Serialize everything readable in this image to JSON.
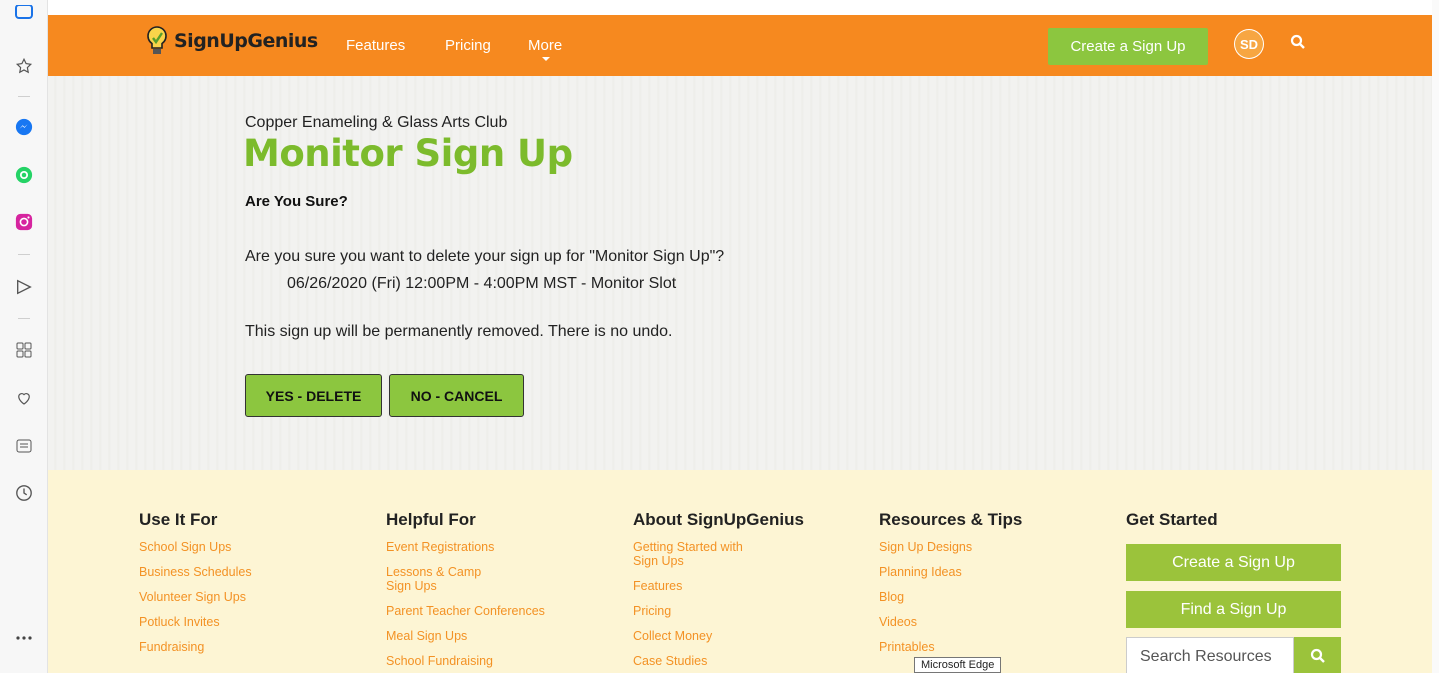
{
  "sidebar": {
    "icons": [
      "app-icon",
      "star-icon",
      "messenger-icon",
      "whatsapp-icon",
      "instagram-icon",
      "send-icon",
      "apps-grid-icon",
      "heart-icon",
      "news-icon",
      "history-icon",
      "more-icon"
    ]
  },
  "nav": {
    "logo_text": "SignUpGenius",
    "links": [
      "Features",
      "Pricing",
      "More"
    ],
    "create_label": "Create a Sign Up",
    "avatar_initials": "SD",
    "accent": "#f6891f"
  },
  "main": {
    "org_name": "Copper Enameling & Glass Arts Club",
    "title": "Monitor Sign Up",
    "subtitle": "Are You Sure?",
    "question": "Are you sure you want to delete your sign up for \"Monitor Sign Up\"?",
    "slot": "06/26/2020 (Fri) 12:00PM - 4:00PM MST - Monitor Slot",
    "warning": "This sign up will be permanently removed. There is no undo.",
    "yes_label": "YES - DELETE",
    "no_label": "NO - CANCEL",
    "title_color": "#7cbb2c"
  },
  "footer": {
    "columns": [
      {
        "heading": "Use It For",
        "links": [
          "School Sign Ups",
          "Business Schedules",
          "Volunteer Sign Ups",
          "Potluck Invites",
          "Fundraising"
        ]
      },
      {
        "heading": "Helpful For",
        "links": [
          "Event Registrations",
          "Lessons & Camp Sign Ups",
          "Parent Teacher Conferences",
          "Meal Sign Ups",
          "School Fundraising"
        ]
      },
      {
        "heading": "About SignUpGenius",
        "links": [
          "Getting Started with Sign Ups",
          "Features",
          "Pricing",
          "Collect Money",
          "Case Studies"
        ]
      },
      {
        "heading": "Resources & Tips",
        "links": [
          "Sign Up Designs",
          "Planning Ideas",
          "Blog",
          "Videos",
          "Printables"
        ]
      }
    ],
    "get_started": {
      "heading": "Get Started",
      "create_label": "Create a Sign Up",
      "find_label": "Find a Sign Up",
      "search_placeholder": "Search Resources"
    }
  },
  "tooltip": "Microsoft Edge"
}
